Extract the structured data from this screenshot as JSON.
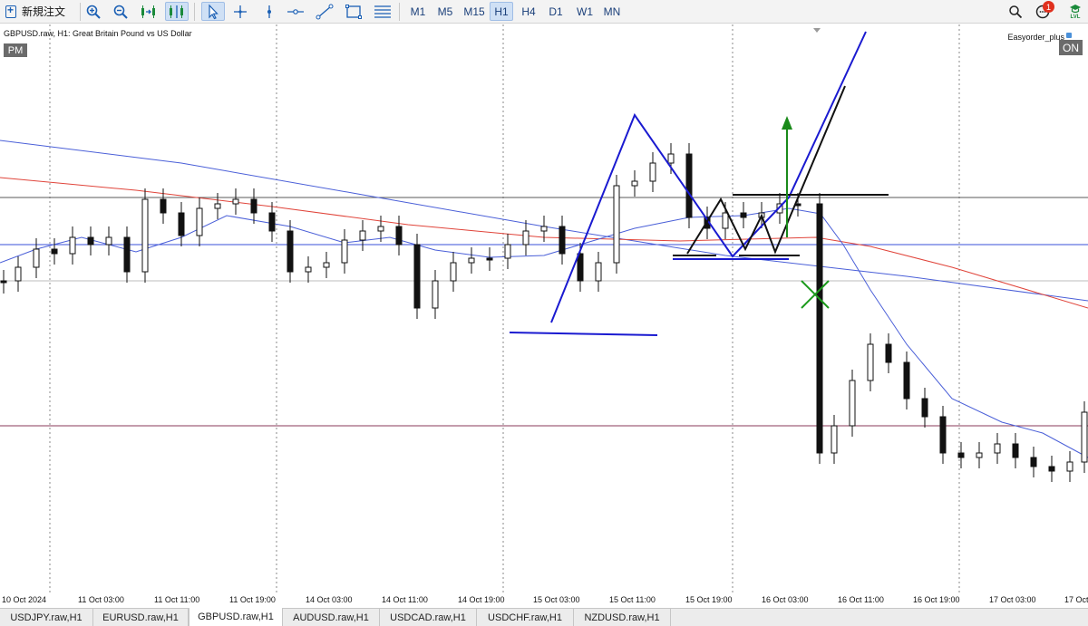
{
  "toolbar": {
    "new_order_label": "新規注文",
    "timeframes": [
      "M1",
      "M5",
      "M15",
      "H1",
      "H4",
      "D1",
      "W1",
      "MN"
    ],
    "selected_timeframe": "H1",
    "notification_count": "1",
    "level_label": "LVL"
  },
  "chart": {
    "info": "GBPUSD.raw, H1:  Great Britain Pound vs US Dollar",
    "pm_badge": "PM",
    "ea_name": "Easyorder_plus",
    "ea_status": "ON"
  },
  "time_axis": [
    "10 Oct 2024",
    "11 Oct 03:00",
    "11 Oct 11:00",
    "11 Oct 19:00",
    "14 Oct 03:00",
    "14 Oct 11:00",
    "14 Oct 19:00",
    "15 Oct 03:00",
    "15 Oct 11:00",
    "15 Oct 19:00",
    "16 Oct 03:00",
    "16 Oct 11:00",
    "16 Oct 19:00",
    "17 Oct 03:00",
    "17 Oct"
  ],
  "tabs": [
    "USDJPY.raw,H1",
    "EURUSD.raw,H1",
    "GBPUSD.raw,H1",
    "AUDUSD.raw,H1",
    "USDCAD.raw,H1",
    "USDCHF.raw,H1",
    "NZDUSD.raw,H1"
  ],
  "active_tab": "GBPUSD.raw,H1",
  "colors": {
    "accent": "#1a3f7a",
    "trendline_blue": "#1a1ad0",
    "ma_red": "#e0443a",
    "ma_blue": "#4a5fd8",
    "arrow_green": "#1a8a1a",
    "cross_green": "#1a9a1a"
  }
}
